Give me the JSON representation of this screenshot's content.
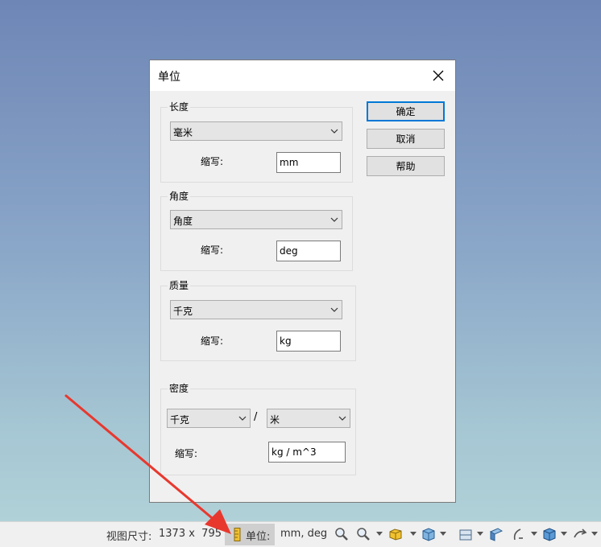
{
  "dialog": {
    "title": "单位",
    "length": {
      "group_label": "长度",
      "unit": "毫米",
      "abbr_label": "缩写:",
      "abbr_value": "mm"
    },
    "angle": {
      "group_label": "角度",
      "unit": "角度",
      "abbr_label": "缩写:",
      "abbr_value": "deg"
    },
    "mass": {
      "group_label": "质量",
      "unit": "千克",
      "abbr_label": "缩写:",
      "abbr_value": "kg"
    },
    "density": {
      "group_label": "密度",
      "mass_unit": "千克",
      "separator": "/",
      "length_unit": "米",
      "abbr_label": "缩写:",
      "abbr_value": "kg / m^3"
    },
    "buttons": {
      "ok": "确定",
      "cancel": "取消",
      "help": "帮助"
    }
  },
  "statusbar": {
    "view_size_label": "视图尺寸:",
    "view_size_value": "1373 x  795",
    "units_label": "单位:",
    "units_value": "mm, deg"
  },
  "colors": {
    "accent": "#0078d7",
    "arrow": "#e8382e"
  },
  "icons": [
    "close-icon",
    "chevron-down-icon",
    "ruler-icon",
    "zoom-icon",
    "zoom-window-icon",
    "view-cube-icon",
    "box-icon",
    "section-icon",
    "shade-icon",
    "view-icon",
    "view-arrow-icon"
  ]
}
